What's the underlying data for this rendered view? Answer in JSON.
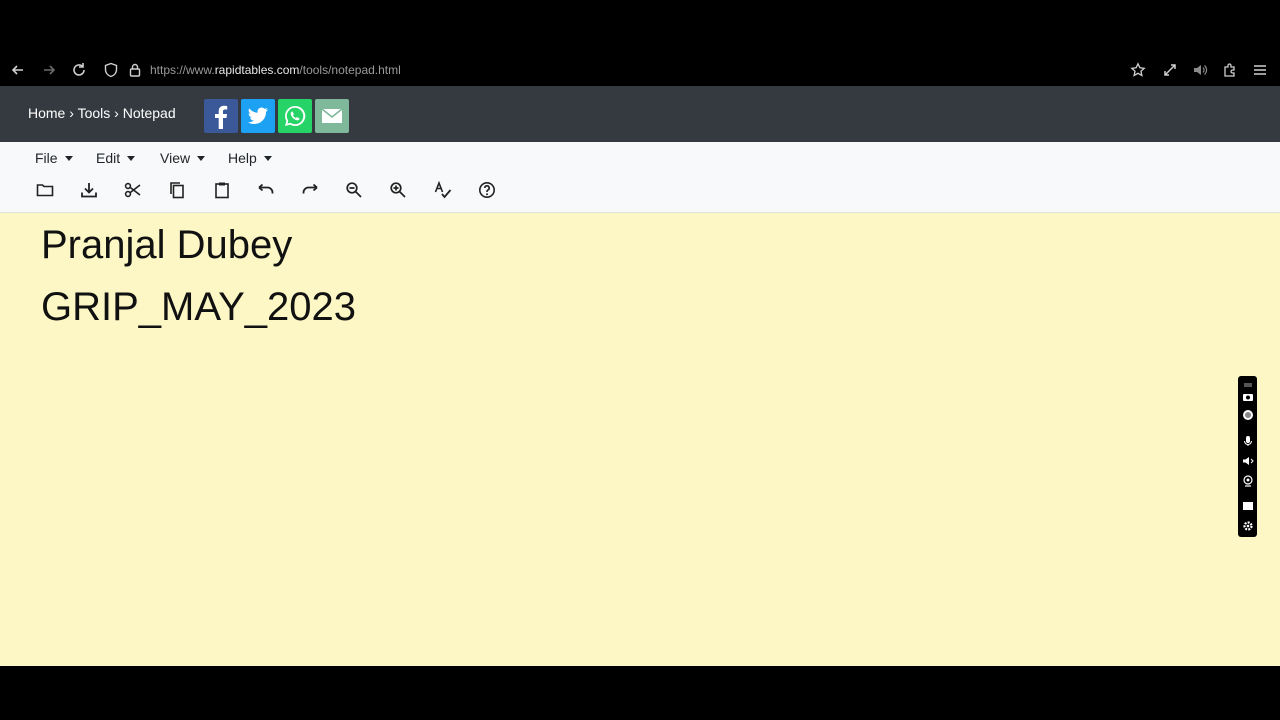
{
  "browser": {
    "url_prefix": "https://www.",
    "url_host": "rapidtables.com",
    "url_path": "/tools/notepad.html"
  },
  "header": {
    "breadcrumb": [
      "Home",
      "Tools",
      "Notepad"
    ],
    "separator": "›",
    "share_buttons": [
      "facebook-icon",
      "twitter-icon",
      "whatsapp-icon",
      "email-icon"
    ]
  },
  "menu": {
    "items": [
      "File",
      "Edit",
      "View",
      "Help"
    ]
  },
  "toolbar": {
    "tools": [
      "open-folder-icon",
      "download-icon",
      "cut-icon",
      "copy-icon",
      "paste-icon",
      "undo-icon",
      "redo-icon",
      "zoom-out-icon",
      "zoom-in-icon",
      "spellcheck-icon",
      "help-icon"
    ]
  },
  "editor": {
    "lines": [
      "Pranjal Dubey",
      "GRIP_MAY_2023"
    ],
    "background": "#fcf7c5"
  },
  "colors": {
    "header_bg": "#343a40",
    "toolbar_bg": "#f8f9fa",
    "facebook": "#3b5998",
    "twitter": "#1da1f2",
    "whatsapp": "#25d366",
    "email": "#7fb89a"
  }
}
